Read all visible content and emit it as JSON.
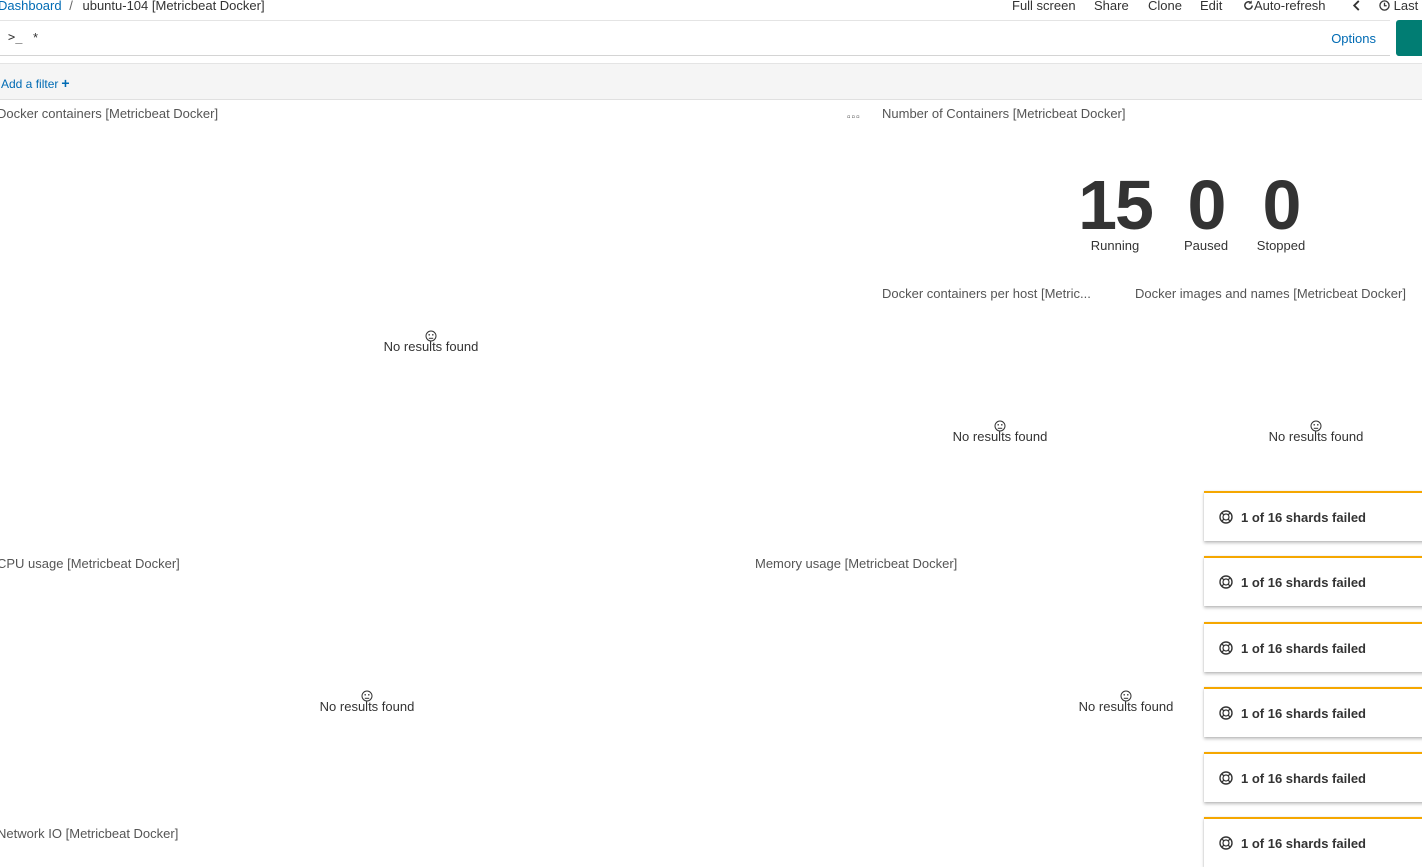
{
  "breadcrumb": {
    "root": "Dashboard",
    "separator": "/",
    "current": "ubuntu-104 [Metricbeat Docker]"
  },
  "top_nav": {
    "full_screen": "Full screen",
    "share": "Share",
    "clone": "Clone",
    "edit": "Edit",
    "auto_refresh": "Auto-refresh",
    "time_label": "Last"
  },
  "query": {
    "prompt": ">_",
    "value": "*",
    "options_label": "Options"
  },
  "filter": {
    "add_label": "Add a filter"
  },
  "panels": {
    "docker_containers": {
      "title": "Docker containers [Metricbeat Docker]",
      "empty": "No results found"
    },
    "number_of_containers": {
      "title": "Number of Containers [Metricbeat Docker]",
      "metrics": [
        {
          "value": "15",
          "label": "Running"
        },
        {
          "value": "0",
          "label": "Paused"
        },
        {
          "value": "0",
          "label": "Stopped"
        }
      ]
    },
    "containers_per_host": {
      "title": "Docker containers per host [Metric...",
      "empty": "No results found"
    },
    "images_and_names": {
      "title": "Docker images and names [Metricbeat Docker]",
      "empty": "No results found"
    },
    "cpu_usage": {
      "title": "CPU usage [Metricbeat Docker]",
      "empty": "No results found"
    },
    "memory_usage": {
      "title": "Memory usage [Metricbeat Docker]",
      "empty": "No results found"
    },
    "network_io": {
      "title": "Network IO [Metricbeat Docker]"
    }
  },
  "toasts": [
    {
      "text": "1 of 16 shards failed"
    },
    {
      "text": "1 of 16 shards failed"
    },
    {
      "text": "1 of 16 shards failed"
    },
    {
      "text": "1 of 16 shards failed"
    },
    {
      "text": "1 of 16 shards failed"
    },
    {
      "text": "1 of 16 shards failed"
    }
  ],
  "colors": {
    "accent": "#006bb4",
    "submit": "#017d73",
    "warning": "#f5a700"
  }
}
